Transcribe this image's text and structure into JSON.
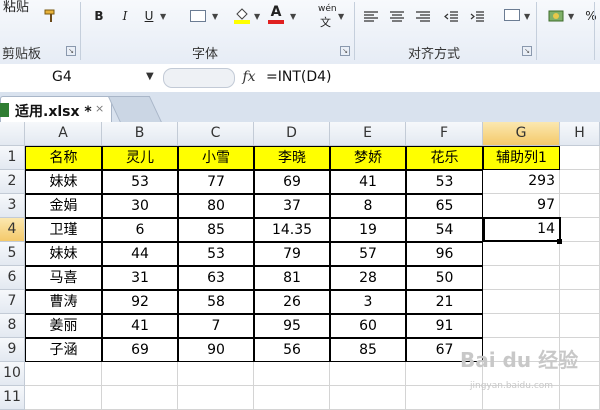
{
  "ribbon": {
    "clipboard": {
      "paste_label": "粘贴",
      "group_label": "剪贴板"
    },
    "font": {
      "group_label": "字体",
      "bold": "B",
      "italic": "I",
      "underline": "U",
      "font_color": "A"
    },
    "alignment": {
      "group_label": "对齐方式",
      "wen_label": "wén"
    },
    "number": {
      "percent": "%"
    }
  },
  "formula_bar": {
    "name_box": "G4",
    "fx_label": "fx",
    "formula": "=INT(D4)"
  },
  "tabs": [
    {
      "label": "适用.xlsx *",
      "close": "×"
    }
  ],
  "sheet": {
    "columns": [
      "A",
      "B",
      "C",
      "D",
      "E",
      "F",
      "G",
      "H"
    ],
    "row_numbers": [
      "1",
      "2",
      "3",
      "4",
      "5",
      "6",
      "7",
      "8",
      "9",
      "10",
      "11"
    ],
    "header_row": [
      "名称",
      "灵儿",
      "小雪",
      "李晓",
      "梦娇",
      "花乐",
      "辅助列1"
    ],
    "rows": [
      [
        "妹妹",
        "53",
        "77",
        "69",
        "41",
        "53",
        "293"
      ],
      [
        "金娟",
        "30",
        "80",
        "37",
        "8",
        "65",
        "97"
      ],
      [
        "卫瑾",
        "6",
        "85",
        "14.35",
        "19",
        "54",
        "14"
      ],
      [
        "妹妹",
        "44",
        "53",
        "79",
        "57",
        "96",
        ""
      ],
      [
        "马喜",
        "31",
        "63",
        "81",
        "28",
        "50",
        ""
      ],
      [
        "曹涛",
        "92",
        "58",
        "26",
        "3",
        "21",
        ""
      ],
      [
        "姜丽",
        "41",
        "7",
        "95",
        "60",
        "91",
        ""
      ],
      [
        "子涵",
        "69",
        "90",
        "56",
        "85",
        "67",
        ""
      ]
    ],
    "selected_cell": "G4"
  },
  "watermark": {
    "text": "Bai du 经验",
    "subtext": "jingyan.baidu.com"
  },
  "colors": {
    "header_fill": "#ffff00",
    "ribbon_bg": "#e6ecf5",
    "active_header": "#f4c96a"
  }
}
